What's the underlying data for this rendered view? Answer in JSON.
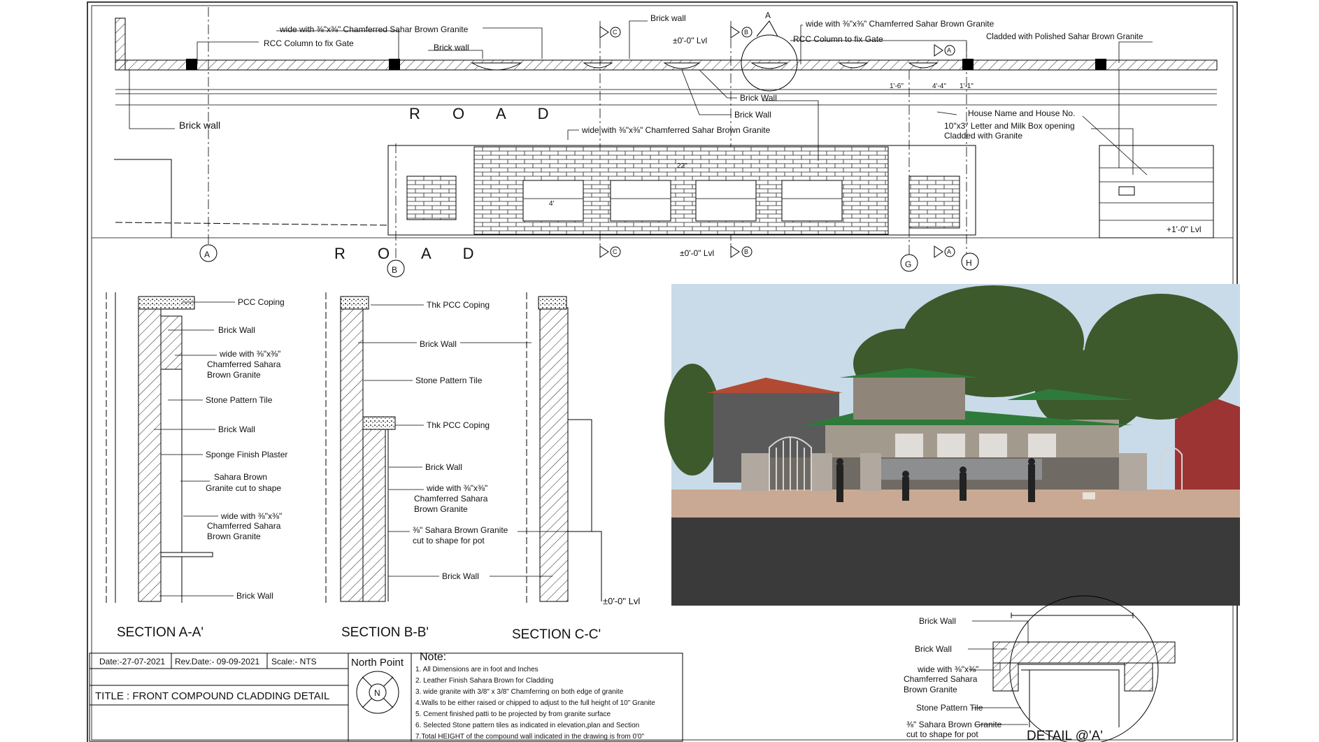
{
  "plan": {
    "road_label": "R O A D",
    "road_label_lower": "R O A D",
    "grid": {
      "a": "A",
      "b": "B",
      "c": "C",
      "g": "G",
      "h": "H",
      "section_a": "A"
    },
    "labels": {
      "chamfer_top_left": "wide with ⅜\"x⅜\" Chamferred Sahar Brown Granite",
      "rcc_left": "RCC Column to fix Gate",
      "brick_wall_top": "Brick wall",
      "brick_wall_center": "Brick wall",
      "level_top": "±0'-0\" Lvl",
      "chamfer_top_right": "wide with ⅜\"x⅜\" Chamferred Sahar Brown Granite",
      "rcc_right": "RCC Column to fix Gate",
      "cladded_right": "Cladded with Polished Sahar Brown Granite",
      "brick_wall_mid1": "Brick Wall",
      "brick_wall_mid2": "Brick Wall",
      "brick_wall_left": "Brick wall",
      "house_name": "House Name and House No.",
      "letter_box": "10\"x3\" Letter and Milk Box opening",
      "cladded_granite": "Cladded with Granite",
      "chamfer_elev": "wide with ⅜\"x⅜\" Chamferred Sahar Brown Granite",
      "dim_a": "1'-6\"",
      "dim_b": "4'-4\"",
      "dim_c": "1'-1\"",
      "dim_4": "4'",
      "dim_22": "22\"",
      "level_bottom": "±0'-0\" Lvl",
      "level_right": "+1'-0\" Lvl"
    }
  },
  "sections": {
    "aa": {
      "title": "SECTION A-A'",
      "labels": [
        "PCC Coping",
        "Brick Wall",
        "wide with ⅜\"x⅜\"",
        "Chamferred Sahara",
        "Brown Granite",
        "Stone Pattern Tile",
        "Brick Wall",
        "Sponge Finish Plaster",
        "Sahara Brown",
        "Granite cut to shape",
        "wide with ⅜\"x⅜\"",
        "Chamferred Sahara",
        "Brown Granite",
        "Brick Wall"
      ]
    },
    "bb": {
      "title": "SECTION B-B'",
      "labels": [
        "Thk PCC Coping",
        "Brick Wall",
        "Stone Pattern Tile",
        "Thk PCC Coping",
        "Brick Wall",
        "wide with ⅜\"x⅜\"",
        "Chamferred Sahara",
        "Brown Granite",
        "⅜\" Sahara Brown Granite",
        "cut to shape for pot",
        "Brick Wall"
      ]
    },
    "cc": {
      "title": "SECTION C-C'",
      "level": "±0'-0\" Lvl"
    }
  },
  "detail": {
    "title": "DETAIL @'A'",
    "labels": [
      "Brick Wall",
      "Brick Wall",
      "wide with ⅜\"x⅜\"",
      "Chamferred Sahara",
      "Brown Granite",
      "Stone Pattern Tile",
      "⅜\" Sahara Brown Granite",
      "cut to shape for pot"
    ]
  },
  "title_block": {
    "date": "Date:-27-07-2021",
    "rev_date": "Rev.Date:- 09-09-2021",
    "scale": "Scale:- NTS",
    "title": "TITLE : FRONT COMPOUND CLADDING DETAIL",
    "north_point": "North Point",
    "north_letter": "N"
  },
  "notes": {
    "heading": "Note:",
    "items": [
      "1. All Dimensions are in foot and Inches",
      "2. Leather Finish Sahara Brown for Cladding",
      "3.       wide granite with 3/8\" x 3/8\" Chamferring on both edge of granite",
      "4.Walls to be either raised or chipped to adjust to the full height of 10\" Granite",
      "5. Cement finished patti to be projected by        from granite surface",
      "6. Selected Stone pattern tiles as indicated in elevation,plan and Section",
      "7.Total HEIGHT of the compound wall indicated in the drawing is from 0'0\""
    ]
  },
  "colors": {
    "sky": "#c9dbe8",
    "road": "#3a3a3a",
    "roof": "#2f7a3a",
    "tile_roof": "#b24a33",
    "wall": "#6f6a63",
    "pavement": "#c9a993"
  }
}
